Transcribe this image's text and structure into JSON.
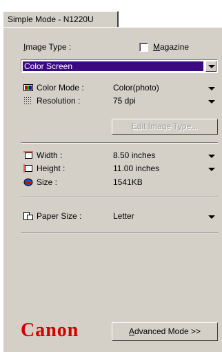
{
  "tab": {
    "label": "Simple Mode - N1220U"
  },
  "image_type": {
    "label": "Image Type :",
    "selected": "Color Screen",
    "magazine_label": "Magazine",
    "magazine_checked": false
  },
  "settings": {
    "color_mode": {
      "label": "Color Mode :",
      "value": "Color(photo)"
    },
    "resolution": {
      "label": "Resolution :",
      "value": "75 dpi"
    },
    "edit_button": "Edit Image Type..."
  },
  "size": {
    "width": {
      "label": "Width :",
      "value": "8.50 inches"
    },
    "height": {
      "label": "Height :",
      "value": "11.00 inches"
    },
    "size": {
      "label": "Size :",
      "value": "1541KB"
    }
  },
  "paper": {
    "label": "Paper Size :",
    "value": "Letter"
  },
  "footer": {
    "logo": "Canon",
    "advanced_button": "Advanced Mode >>"
  },
  "colors": {
    "selection": "#3b0a82",
    "logo": "#d40000",
    "panel": "#d4d0c8"
  }
}
